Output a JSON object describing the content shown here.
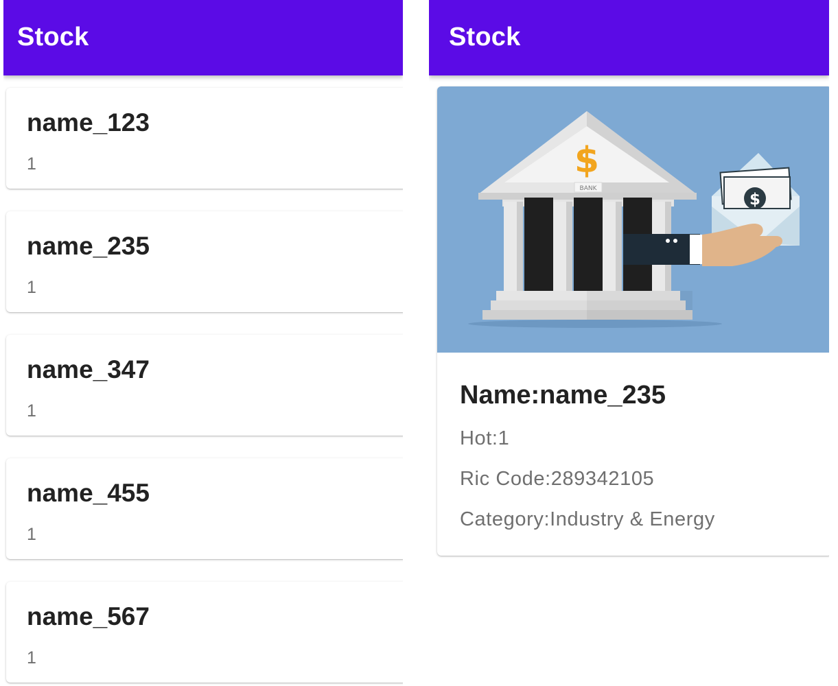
{
  "list_screen": {
    "app_bar_title": "Stock",
    "items": [
      {
        "name": "name_123",
        "value": "1"
      },
      {
        "name": "name_235",
        "value": "1"
      },
      {
        "name": "name_347",
        "value": "1"
      },
      {
        "name": "name_455",
        "value": "1"
      },
      {
        "name": "name_567",
        "value": "1"
      }
    ]
  },
  "detail_screen": {
    "app_bar_title": "Stock",
    "image": {
      "icon": "bank-payment-illustration",
      "bank_label": "BANK"
    },
    "name_line": "Name:name_235",
    "hot_line": "Hot:1",
    "ric_code_line": "Ric Code:289342105",
    "category_line": "Category:Industry & Energy"
  },
  "colors": {
    "app_bar": "#5b0be6",
    "app_bar_text": "#ffffff",
    "image_background": "#7ea9d3",
    "title_text": "#222222",
    "secondary_text": "#6f6f6f"
  }
}
